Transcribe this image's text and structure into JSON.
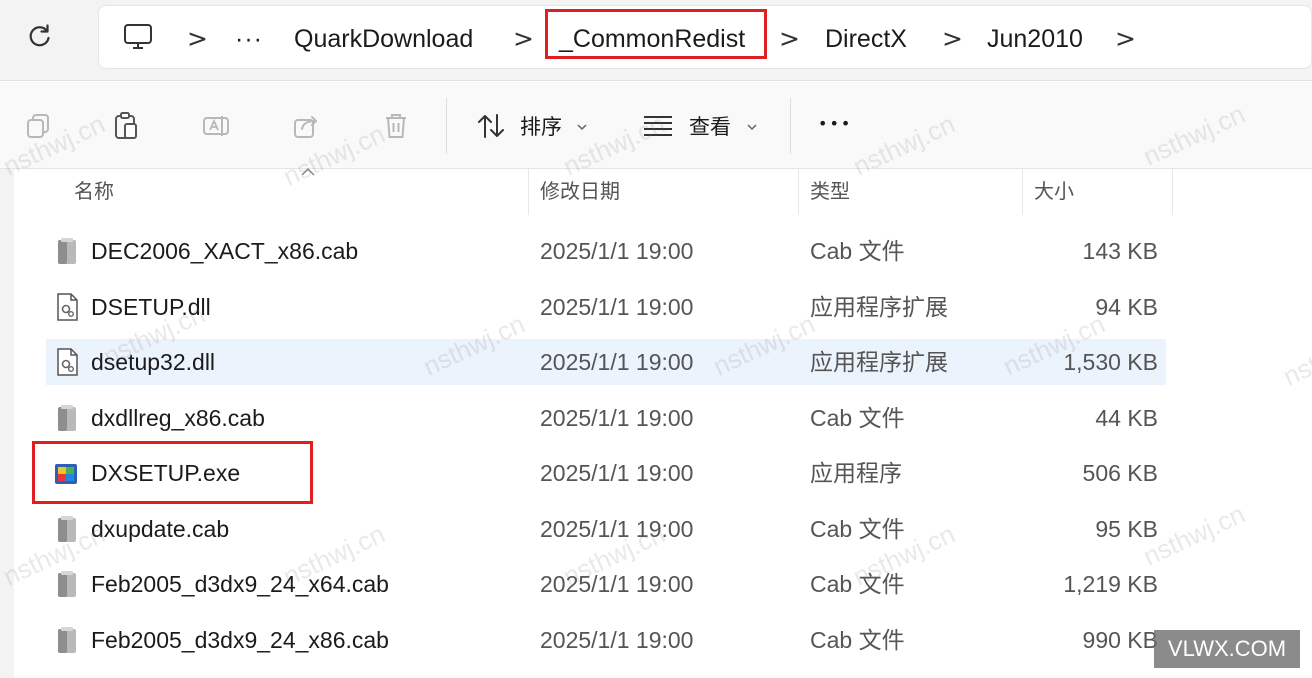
{
  "address_bar": {
    "crumbs": [
      "QuarkDownload",
      "_CommonRedist",
      "DirectX",
      "Jun2010"
    ],
    "overflow": "···",
    "separator": ">"
  },
  "toolbar": {
    "sort_label": "排序",
    "view_label": "查看",
    "more_label": "•••"
  },
  "columns": {
    "name": "名称",
    "date": "修改日期",
    "type": "类型",
    "size": "大小"
  },
  "files": [
    {
      "name": "DEC2006_XACT_x86.cab",
      "date": "2025/1/1 19:00",
      "type": "Cab 文件",
      "size": "143 KB",
      "icon": "cab-icon"
    },
    {
      "name": "DSETUP.dll",
      "date": "2025/1/1 19:00",
      "type": "应用程序扩展",
      "size": "94 KB",
      "icon": "dll-icon"
    },
    {
      "name": "dsetup32.dll",
      "date": "2025/1/1 19:00",
      "type": "应用程序扩展",
      "size": "1,530 KB",
      "icon": "dll-icon",
      "selected": true
    },
    {
      "name": "dxdllreg_x86.cab",
      "date": "2025/1/1 19:00",
      "type": "Cab 文件",
      "size": "44 KB",
      "icon": "cab-icon"
    },
    {
      "name": "DXSETUP.exe",
      "date": "2025/1/1 19:00",
      "type": "应用程序",
      "size": "506 KB",
      "icon": "exe-icon"
    },
    {
      "name": "dxupdate.cab",
      "date": "2025/1/1 19:00",
      "type": "Cab 文件",
      "size": "95 KB",
      "icon": "cab-icon"
    },
    {
      "name": "Feb2005_d3dx9_24_x64.cab",
      "date": "2025/1/1 19:00",
      "type": "Cab 文件",
      "size": "1,219 KB",
      "icon": "cab-icon"
    },
    {
      "name": "Feb2005_d3dx9_24_x86.cab",
      "date": "2025/1/1 19:00",
      "type": "Cab 文件",
      "size": "990 KB",
      "icon": "cab-icon"
    }
  ],
  "highlight_color": "#e02020",
  "selection_color": "#ebf3fd",
  "watermark": "nsthwj.cn",
  "corner_badge": "VLWX.COM"
}
